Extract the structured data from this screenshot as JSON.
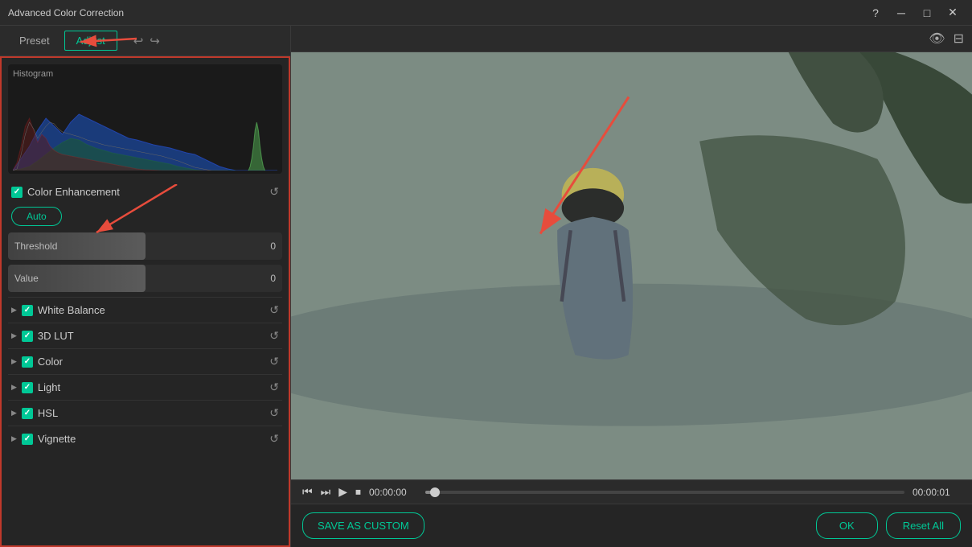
{
  "titleBar": {
    "title": "Advanced Color Correction",
    "helpIcon": "?",
    "minimizeIcon": "─",
    "maximizeIcon": "□",
    "closeIcon": "✕"
  },
  "tabs": {
    "preset": "Preset",
    "adjust": "Adjust"
  },
  "toolbar": {
    "undoIcon": "↩",
    "redoIcon": "↪"
  },
  "topRightIcons": {
    "viewIcon": "👁",
    "compareIcon": "⊟"
  },
  "histogram": {
    "label": "Histogram"
  },
  "colorEnhancement": {
    "label": "Color Enhancement",
    "checked": true
  },
  "autoButton": {
    "label": "Auto"
  },
  "sliders": [
    {
      "label": "Threshold",
      "value": "0"
    },
    {
      "label": "Value",
      "value": "0"
    }
  ],
  "sectionItems": [
    {
      "label": "White Balance",
      "checked": true
    },
    {
      "label": "3D LUT",
      "checked": true
    },
    {
      "label": "Color",
      "checked": true
    },
    {
      "label": "Light",
      "checked": true
    },
    {
      "label": "HSL",
      "checked": true
    },
    {
      "label": "Vignette",
      "checked": true
    }
  ],
  "playback": {
    "rewindIcon": "⏮",
    "prevIcon": "⏭",
    "playIcon": "▶",
    "stopIcon": "⏹",
    "currentTime": "00:00:00",
    "totalTime": "00:00:01",
    "progressPercent": 2
  },
  "actionBar": {
    "saveAsCustom": "SAVE AS CUSTOM",
    "ok": "OK",
    "resetAll": "Reset All"
  }
}
